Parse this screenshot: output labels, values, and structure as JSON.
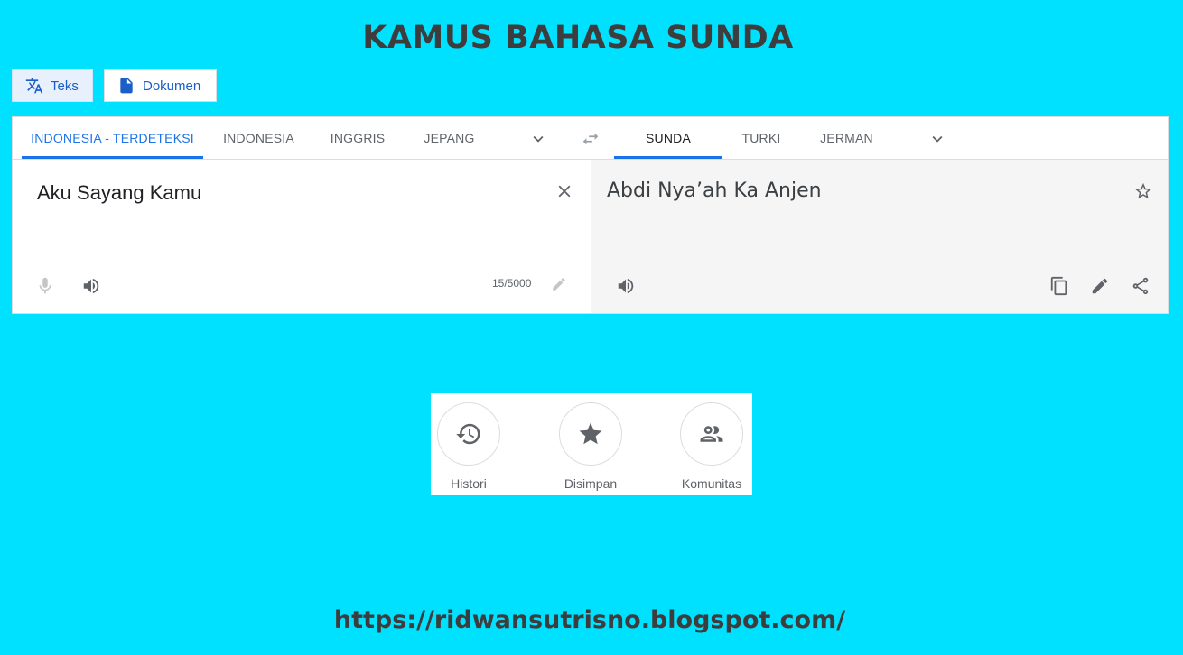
{
  "page": {
    "title": "KAMUS BAHASA SUNDA",
    "footer_url": "https://ridwansutrisno.blogspot.com/"
  },
  "modes": {
    "teks": "Teks",
    "dokumen": "Dokumen"
  },
  "source_tabs": [
    "INDONESIA - TERDETEKSI",
    "INDONESIA",
    "INGGRIS",
    "JEPANG"
  ],
  "target_tabs": [
    "SUNDA",
    "TURKI",
    "JERMAN"
  ],
  "source": {
    "text": "Aku Sayang Kamu",
    "counter": "15/5000"
  },
  "target": {
    "text": "Abdi Nya’ah Ka Anjen"
  },
  "bottom": {
    "histori": "Histori",
    "disimpan": "Disimpan",
    "komunitas": "Komunitas"
  },
  "colors": {
    "background": "#00e0ff",
    "accent": "#1a73e8"
  }
}
